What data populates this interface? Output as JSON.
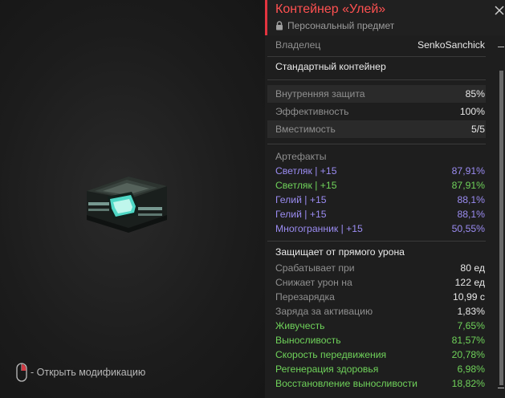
{
  "hint": {
    "label": "- Открыть модификацию",
    "icon": "mouse-icon"
  },
  "panel": {
    "title": "Контейнер «Улей»",
    "subtitle": "Персональный предмет",
    "owner": {
      "label": "Владелец",
      "value": "SenkoSanchick"
    },
    "type_label": "Стандартный контейнер",
    "stats": [
      {
        "label": "Внутренняя защита",
        "value": "85%"
      },
      {
        "label": "Эффективность",
        "value": "100%"
      },
      {
        "label": "Вместимость",
        "value": "5/5"
      }
    ],
    "artifacts_title": "Артефакты",
    "artifacts": [
      {
        "name": "Светляк | +15",
        "value": "87,91%",
        "color": "#9b8cf2"
      },
      {
        "name": "Светляк | +15",
        "value": "87,91%",
        "color": "#6fd25a"
      },
      {
        "name": "Гелий | +15",
        "value": "88,1%",
        "color": "#9b8cf2"
      },
      {
        "name": "Гелий | +15",
        "value": "88,1%",
        "color": "#9b8cf2"
      },
      {
        "name": "Многогранник | +15",
        "value": "50,55%",
        "color": "#9b8cf2"
      }
    ],
    "protection_title": "Защищает от прямого урона",
    "protection": [
      {
        "label": "Срабатывает при",
        "value": "80 ед"
      },
      {
        "label": "Снижает урон на",
        "value": "122 ед"
      },
      {
        "label": "Перезарядка",
        "value": "10,99 с"
      },
      {
        "label": "Заряда за активацию",
        "value": "1,83%"
      }
    ],
    "bonuses": [
      {
        "label": "Живучесть",
        "value": "7,65%"
      },
      {
        "label": "Выносливость",
        "value": "81,57%"
      },
      {
        "label": "Скорость передвижения",
        "value": "20,78%"
      },
      {
        "label": "Регенерация здоровья",
        "value": "6,98%"
      },
      {
        "label": "Восстановление выносливости",
        "value": "18,82%"
      }
    ]
  },
  "colors": {
    "accent": "#e3343f",
    "title": "#ff5151",
    "purple": "#9b8cf2",
    "green": "#6fd25a"
  }
}
